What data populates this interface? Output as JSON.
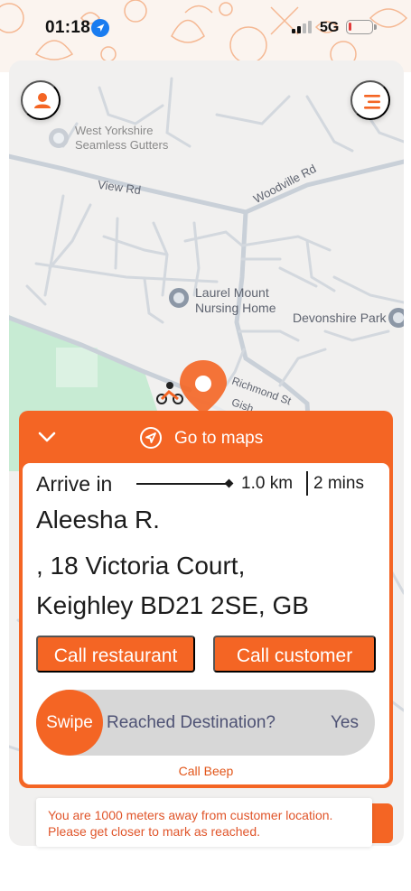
{
  "status_bar": {
    "time": "01:18",
    "network": "5G",
    "location_icon": "location-arrow-icon",
    "signal_icon": "signal-bars-icon",
    "battery_icon": "battery-low-icon",
    "battery_level": 0.1
  },
  "map": {
    "labels": {
      "poi_1": "West Yorkshire\nSeamless Gutters",
      "road_view": "View Rd",
      "road_woodville": "Woodville Rd",
      "poi_2": "Laurel Mount\nNursing Home",
      "poi_3": "Devonshire Park",
      "road_richmond": "Richmond St",
      "road_gish": "Gish"
    },
    "profile_icon": "user-icon",
    "menu_icon": "menu-icon",
    "destination_icon": "map-pin-icon",
    "rider_icon": "rider-icon"
  },
  "sheet": {
    "collapse_icon": "chevron-down-icon",
    "navigate_icon": "navigation-icon",
    "go_to_maps": "Go to maps",
    "arrive_label": "Arrive in",
    "distance": "1.0 km",
    "eta": "2 mins",
    "customer_name": "Aleesha R.",
    "address_line1": ", 18 Victoria Court,",
    "address_line2": "Keighley BD21 2SE, GB",
    "call_restaurant": "Call restaurant",
    "call_customer": "Call customer",
    "swipe_label": "Swipe",
    "swipe_prompt": "Reached Destination?",
    "swipe_confirm": "Yes",
    "call_beep": "Call Beep"
  },
  "toast": {
    "line1": "You are 1000 meters away from customer location.",
    "line2": "Please get closer to mark as reached."
  },
  "colors": {
    "accent": "#f46524",
    "map_background": "#f1f0ef",
    "park_green": "#c7ebd3",
    "swipe_track": "#d7d7d7",
    "swipe_text": "#4e5274",
    "toast_text": "#e0552a"
  }
}
